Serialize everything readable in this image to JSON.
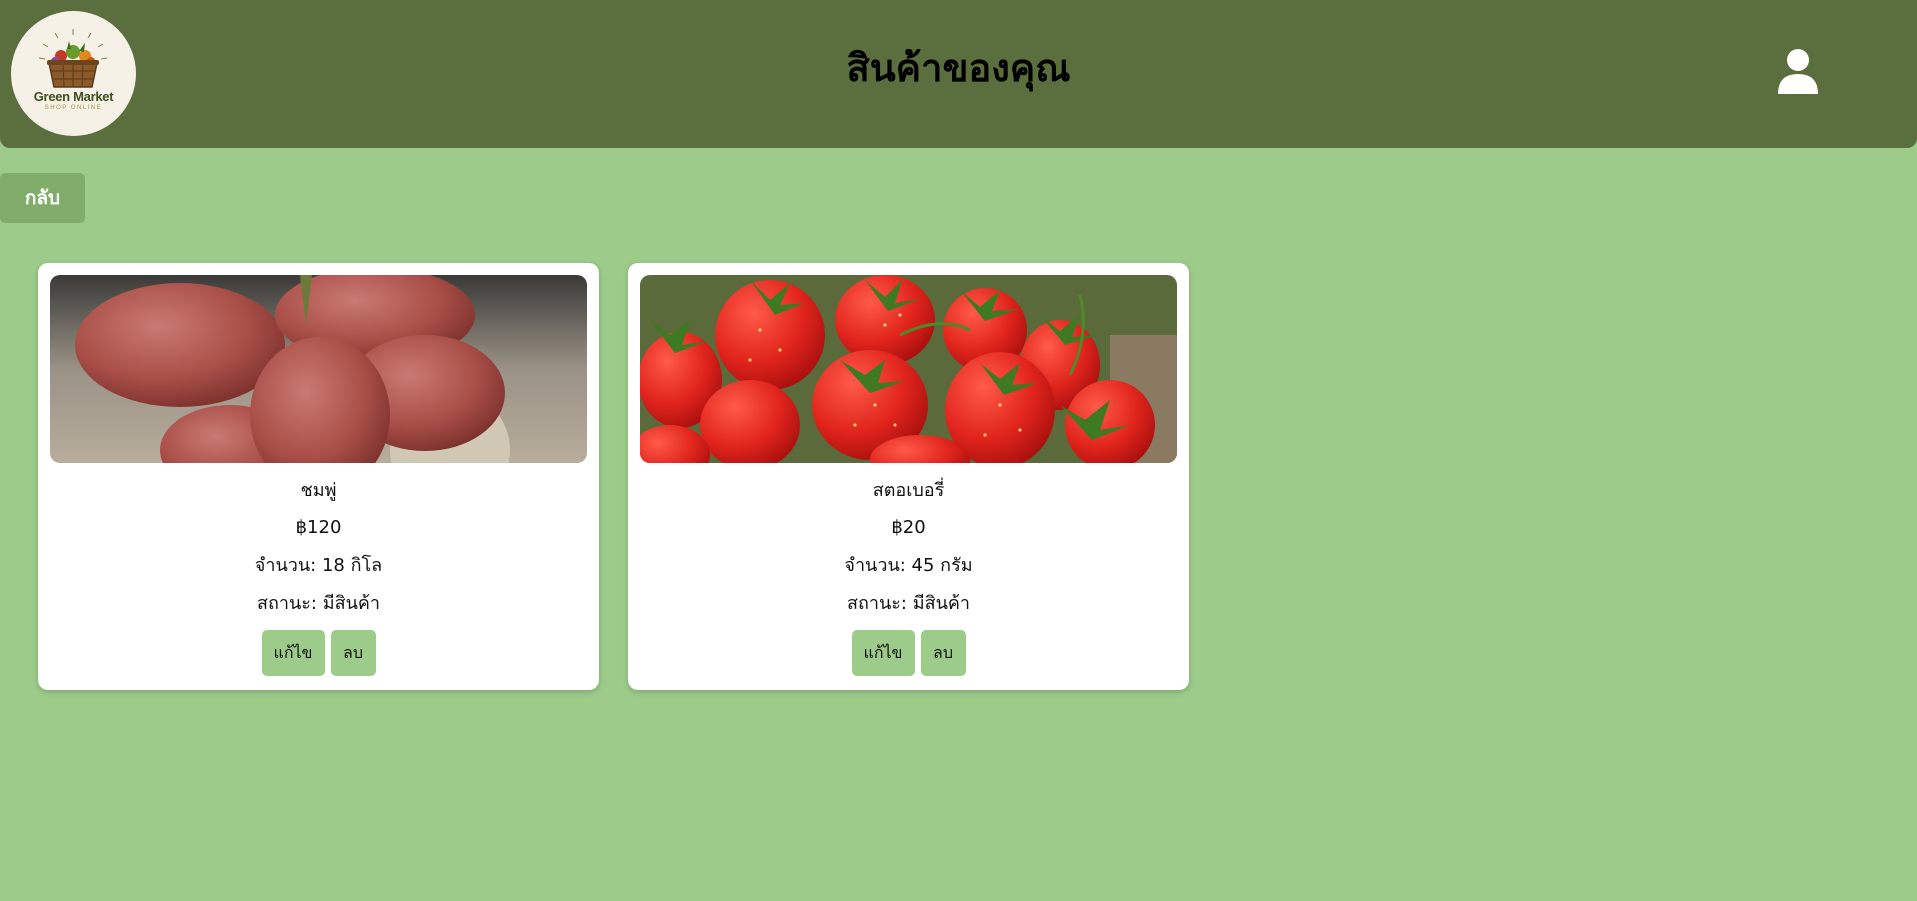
{
  "header": {
    "logo": {
      "brand": "Green Market",
      "tagline": "SHOP ONLINE"
    },
    "title": "สินค้าของคุณ",
    "profile_icon": "user-icon"
  },
  "back_button": {
    "label": "กลับ"
  },
  "products": [
    {
      "name": "ชมพู่",
      "price": "฿120",
      "quantity": "จำนวน: 18 กิโล",
      "status": "สถานะ: มีสินค้า",
      "edit_label": "แก้ไข",
      "delete_label": "ลบ"
    },
    {
      "name": "สตอเบอรี่",
      "price": "฿20",
      "quantity": "จำนวน: 45 กรัม",
      "status": "สถานะ: มีสินค้า",
      "edit_label": "แก้ไข",
      "delete_label": "ลบ"
    }
  ],
  "colors": {
    "background": "#9ccb8a",
    "header": "#5a6e3e",
    "back_button": "#80ad6a",
    "card_button": "#9ccb8a"
  }
}
